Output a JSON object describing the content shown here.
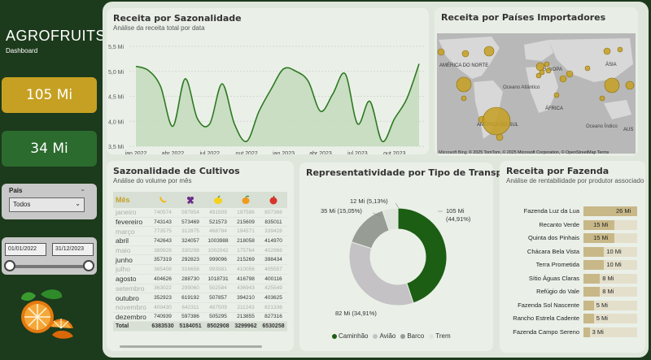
{
  "brand": {
    "title": "AGROFRUITS",
    "subtitle": "Dashboard"
  },
  "kpis": [
    {
      "value": "105 Mi",
      "color": "#c6a022"
    },
    {
      "value": "34 Mi",
      "color": "#2b6b2e"
    }
  ],
  "filters": {
    "country_label": "País",
    "country_value": "Todos",
    "date_start": "01/01/2022",
    "date_end": "31/12/2023"
  },
  "season": {
    "title": "Receita por Sazonalidade",
    "subtitle": "Análise da receita total por data",
    "chart_data": {
      "type": "area",
      "title": "Receita por Sazonalidade",
      "ylim": [
        3.5,
        5.5
      ],
      "yticks": [
        "5,5 Mi",
        "5,0 Mi",
        "4,5 Mi",
        "4,0 Mi",
        "3,5 Mi"
      ],
      "yvals": [
        5.5,
        5.0,
        4.5,
        4.0,
        3.5
      ],
      "xticks": [
        "jan 2022",
        "abr 2022",
        "jul 2022",
        "out 2022",
        "jan 2023",
        "abr 2023",
        "jul 2023",
        "out 2023"
      ],
      "x_index": [
        0,
        3,
        6,
        9,
        12,
        15,
        18,
        21
      ],
      "values": [
        5.1,
        5.02,
        4.7,
        3.9,
        4.85,
        4.05,
        3.95,
        4.75,
        3.95,
        3.6,
        4.2,
        4.65,
        5.05,
        5.0,
        4.8,
        4.2,
        4.55,
        4.95,
        3.95,
        4.4,
        3.6,
        4.05,
        4.45,
        5.15
      ]
    }
  },
  "map": {
    "title": "Receita por Países Importadores",
    "labels": [
      "AMÉRICA DO NORTE",
      "EUROPA",
      "ÁSIA",
      "Oceano Atlântico",
      "ÁFRICA",
      "AMÉRICA DO SUL",
      "Oceano Índico",
      "AUS"
    ],
    "attribution": "© 2025 TomTom, © 2025 Microsoft Corporation, © OpenStreetMap  Terms",
    "brand": "Microsoft Bing"
  },
  "crops": {
    "title": "Sazonalidade de Cultivos",
    "subtitle": "Análise do volume por mês",
    "header": "Mês",
    "fruit_icons": [
      "banana-icon",
      "grape-icon",
      "lemon-icon",
      "mango-icon",
      "apple-icon"
    ],
    "fruit_colors": [
      "#f2b81e",
      "#6a2a8a",
      "#f5d21a",
      "#f09a1a",
      "#d8342a"
    ],
    "rows": [
      {
        "month": "janeiro",
        "v": [
          "740574",
          "597854",
          "491509",
          "197586",
          "807366"
        ],
        "faded": true
      },
      {
        "month": "fevereiro",
        "v": [
          "743143",
          "573469",
          "521573",
          "215609",
          "835011"
        ],
        "faded": false
      },
      {
        "month": "março",
        "v": [
          "773575",
          "312875",
          "468784",
          "194571",
          "339428"
        ],
        "faded": true
      },
      {
        "month": "abril",
        "v": [
          "742643",
          "324057",
          "1003988",
          "218058",
          "414970"
        ],
        "faded": false
      },
      {
        "month": "maio",
        "v": [
          "389928",
          "330298",
          "1002042",
          "175764",
          "402966"
        ],
        "faded": true
      },
      {
        "month": "junho",
        "v": [
          "357319",
          "292823",
          "999096",
          "215269",
          "398434"
        ],
        "faded": false
      },
      {
        "month": "julho",
        "v": [
          "365408",
          "316658",
          "993581",
          "410056",
          "405557"
        ],
        "faded": true
      },
      {
        "month": "agosto",
        "v": [
          "404626",
          "288730",
          "1018731",
          "416798",
          "400116"
        ],
        "faded": false
      },
      {
        "month": "setembro",
        "v": [
          "363022",
          "299060",
          "502584",
          "436943",
          "425549"
        ],
        "faded": true
      },
      {
        "month": "outubro",
        "v": [
          "352923",
          "619192",
          "507857",
          "394210",
          "403625"
        ],
        "faded": false
      },
      {
        "month": "novembro",
        "v": [
          "409430",
          "642311",
          "487509",
          "211243",
          "821336"
        ],
        "faded": true
      },
      {
        "month": "dezembro",
        "v": [
          "740939",
          "597386",
          "505295",
          "213855",
          "827316"
        ],
        "faded": false
      }
    ],
    "total": {
      "month": "Total",
      "v": [
        "6383530",
        "5184051",
        "8502908",
        "3299962",
        "6530258"
      ]
    }
  },
  "transport": {
    "title": "Representatividade por Tipo de Transporte",
    "chart_data": {
      "type": "pie",
      "slices": [
        {
          "name": "Caminhão",
          "value": 105,
          "label": "105 Mi",
          "pct": "(44,91%)",
          "color": "#1c5e14"
        },
        {
          "name": "Avião",
          "value": 82,
          "label": "82 Mi (34,91%)",
          "pct": "",
          "color": "#c4c2c4"
        },
        {
          "name": "Barco",
          "value": 35,
          "label": "35 Mi (15,05%)",
          "pct": "",
          "color": "#979c94"
        },
        {
          "name": "Trem",
          "value": 12,
          "label": "12 Mi (5,13%)",
          "pct": "",
          "color": "#dfe5dc"
        }
      ]
    }
  },
  "farm": {
    "title": "Receita por Fazenda",
    "subtitle": "Análise de rentabilidade por produtor associado",
    "chart_data": {
      "type": "bar",
      "max": 26,
      "categories": [
        "Fazenda Luz da Lua",
        "Recanto Verde",
        "Quinta dos Pinhais",
        "Chácara Bela Vista",
        "Terra Prometida",
        "Sítio Águas Claras",
        "Refúgio do Vale",
        "Fazenda Sol Nascente",
        "Rancho Estrela Cadente",
        "Fazenda Campo Sereno"
      ],
      "values": [
        26,
        15,
        15,
        10,
        10,
        8,
        8,
        5,
        5,
        3
      ],
      "labels": [
        "26 Mi",
        "15 Mi",
        "15 Mi",
        "10 Mi",
        "10 Mi",
        "8 Mi",
        "8 Mi",
        "5 Mi",
        "5 Mi",
        "3 Mi"
      ]
    }
  }
}
